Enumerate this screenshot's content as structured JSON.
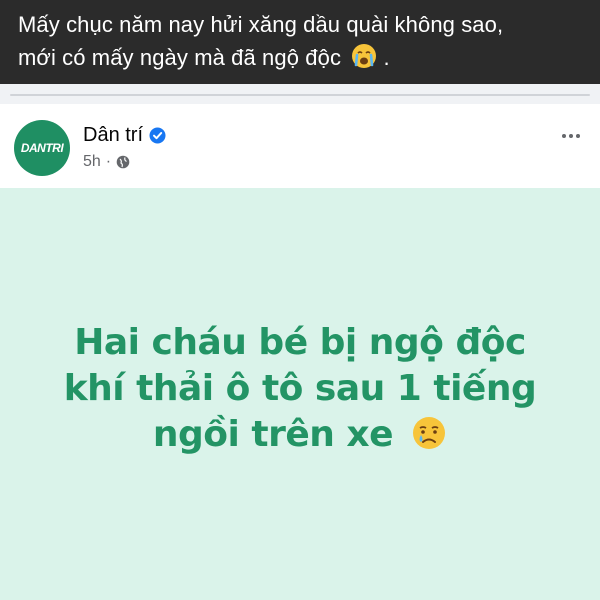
{
  "caption": {
    "line1": "Mấy chục năm nay hửi xăng dầu quài không sao,",
    "line2": "mới có mấy ngày mà đã ngộ độc",
    "line2_end": ".",
    "emoji": "crying-face-emoji"
  },
  "post": {
    "page_name": "Dân trí",
    "logo_text": "DANTRI",
    "time": "5h",
    "separator": "·",
    "verified_icon": "verified-badge-icon",
    "privacy_icon": "globe-icon",
    "more_icon": "more-options-icon",
    "headline": {
      "line1": "Hai cháu bé bị ngộ độc",
      "line2": "khí thải ô tô sau 1 tiếng",
      "line3": "ngồi trên xe",
      "emoji": "sad-tear-face-emoji"
    }
  },
  "colors": {
    "caption_bg": "#2b2b2b",
    "brand_green": "#1f8f63",
    "headline_green": "#239465",
    "card_bg": "#daf3ea",
    "verified_blue": "#1877f2"
  }
}
